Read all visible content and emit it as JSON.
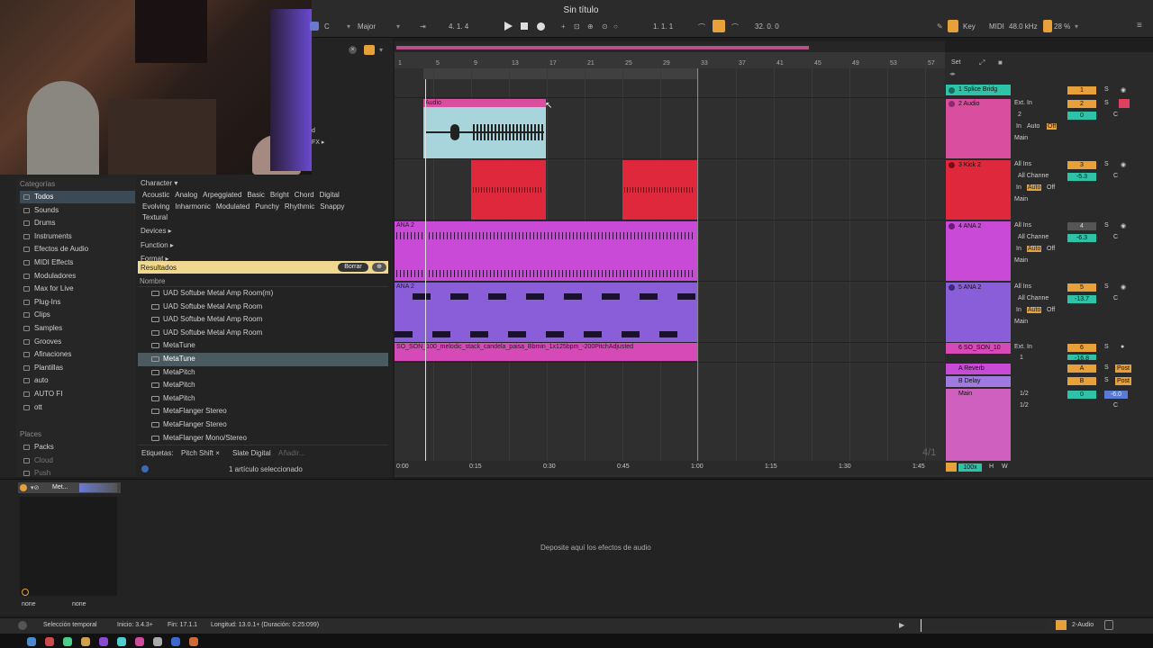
{
  "window": {
    "title": "Sin título"
  },
  "transport": {
    "key": "C",
    "scale": "Major",
    "position": "4.  1.  4",
    "loop_start": "1.  1.  1",
    "loop_length": "32.  0.  0",
    "key_label": "Key",
    "midi_label": "MIDI",
    "sample_rate": "48.0 kHz",
    "cpu": "28 %"
  },
  "browser": {
    "categories_header": "Categorías",
    "categories": [
      "Todos",
      "Sounds",
      "Drums",
      "Instruments",
      "Efectos de Audio",
      "MIDI Effects",
      "Moduladores",
      "Max for Live",
      "Plug-Ins",
      "Clips",
      "Samples",
      "Grooves",
      "Afinaciones",
      "Plantillas",
      "auto",
      "AUTO FI",
      "ott"
    ],
    "places_header": "Places",
    "places": [
      "Packs",
      "Cloud",
      "Push"
    ],
    "filter_character": "Character ▾",
    "character_tags_row1": [
      "Acoustic",
      "Analog",
      "Arpeggiated",
      "Basic",
      "Bright",
      "Chord",
      "Digital"
    ],
    "character_tags_row2": [
      "Evolving",
      "Inharmonic",
      "Modulated",
      "Punchy",
      "Rhythmic",
      "Snappy"
    ],
    "character_tags_row3": [
      "Textural"
    ],
    "filter_devices": "Devices ▸",
    "filter_function": "Function ▸",
    "filter_format": "Format ▸",
    "results_label": "Resultados",
    "clear_button": "Borrar",
    "name_header": "Nombre",
    "results": [
      "UAD Softube Metal Amp Room(m)",
      "UAD Softube Metal Amp Room",
      "UAD Softube Metal Amp Room",
      "UAD Softube Metal Amp Room",
      "MetaTune",
      "MetaTune",
      "MetaPitch",
      "MetaPitch",
      "MetaPitch",
      "MetaFlanger Stereo",
      "MetaFlanger Stereo",
      "MetaFlanger Mono/Stereo"
    ],
    "tags_label": "Etiquetas:",
    "tag_chips": [
      "Pitch Shift ×",
      "Slate Digital"
    ],
    "tag_add": "Añadir...",
    "selection_status": "1 artículo seleccionado",
    "webcam_text_1": "d",
    "webcam_text_2": "FX ▸"
  },
  "arrangement": {
    "ruler_bars": [
      "1",
      "5",
      "9",
      "13",
      "17",
      "21",
      "25",
      "29",
      "33",
      "37",
      "41",
      "45",
      "49",
      "53",
      "57"
    ],
    "time_labels": [
      "0:00",
      "0:15",
      "0:30",
      "0:45",
      "1:00",
      "1:15",
      "1:30",
      "1:45"
    ],
    "clips": {
      "audio": "Audio",
      "ana2a": "ANA 2",
      "ana2b": "ANA 2",
      "so_son": "SO_SON_100_melodic_stack_candela_paisa_Bbmin_1x125bpm_-200PitchAdjusted"
    },
    "time_sig": "4/1",
    "set_label": "Set"
  },
  "tracks": [
    {
      "name": "1 Splice Bridg",
      "color": "#2ec2a8",
      "input": "",
      "channel": "",
      "number": "1",
      "vol": ""
    },
    {
      "name": "2 Audio",
      "color": "#d94e9e",
      "input": "Ext. In",
      "channel": "2",
      "number": "2",
      "vol": "0",
      "pan": "C",
      "monitor": [
        "In",
        "Auto",
        "Off"
      ],
      "out": "Main"
    },
    {
      "name": "3 Kick 2",
      "color": "#e0283c",
      "input": "All Ins",
      "channel": "All Channe",
      "number": "3",
      "vol": "-5.3",
      "pan": "C",
      "monitor": [
        "In",
        "Auto",
        "Off"
      ],
      "out": "Main"
    },
    {
      "name": "4 ANA 2",
      "color": "#c84ad6",
      "input": "All Ins",
      "channel": "All Channe",
      "number": "4",
      "vol": "-6.3",
      "pan": "C",
      "monitor": [
        "In",
        "Auto",
        "Off"
      ],
      "out": "Main"
    },
    {
      "name": "5 ANA 2",
      "color": "#8a5ed8",
      "input": "All Ins",
      "channel": "All Channe",
      "number": "5",
      "vol": "-13.7",
      "pan": "C",
      "monitor": [
        "In",
        "Auto",
        "Off"
      ],
      "out": "Main"
    },
    {
      "name": "6 SO_SON_10",
      "color": "#d64ab8",
      "input": "Ext. In",
      "channel": "1",
      "number": "6",
      "vol": "-16.8",
      "pan": "C"
    },
    {
      "name": "A Reverb",
      "color": "#c84ad6",
      "number": "A",
      "vol": "",
      "post": "Post"
    },
    {
      "name": "B Delay",
      "color": "#a07ae0",
      "number": "B",
      "vol": "",
      "post": "Post"
    },
    {
      "name": "Main",
      "color": "#d060c0",
      "number": "0",
      "vol": "-6.0",
      "in1": "1/2",
      "in2": "1/2",
      "pan": "C"
    }
  ],
  "mixer": {
    "zoom": "100x",
    "h": "H",
    "w": "W"
  },
  "device": {
    "title": "Met...",
    "drop_text": "Deposite aquí los efectos de audio",
    "none1": "none",
    "none2": "none"
  },
  "status": {
    "selection": "Selección temporal",
    "start": "Inicio: 3.4.3+",
    "end": "Fin: 17.1.1",
    "length": "Longitud: 13.0.1+ (Duración: 0:25:099)",
    "track": "2-Audio"
  }
}
